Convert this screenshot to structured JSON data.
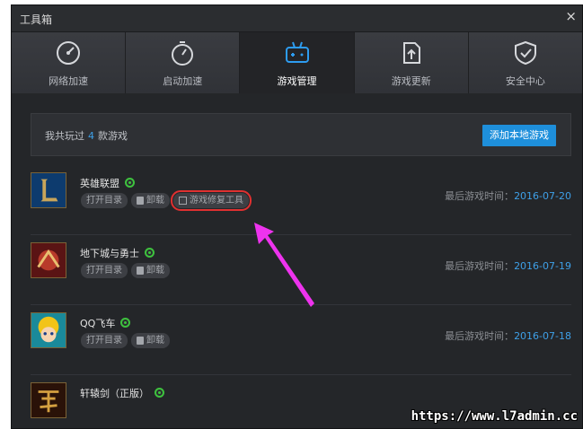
{
  "window": {
    "title": "工具箱",
    "close": "×"
  },
  "tabs": [
    {
      "label": "网络加速",
      "icon": "speedometer-icon"
    },
    {
      "label": "启动加速",
      "icon": "stopwatch-icon"
    },
    {
      "label": "游戏管理",
      "icon": "gamepad-icon",
      "active": true
    },
    {
      "label": "游戏更新",
      "icon": "update-arrow-icon"
    },
    {
      "label": "安全中心",
      "icon": "shield-check-icon"
    }
  ],
  "summary": {
    "prefix": "我共玩过",
    "count": "4",
    "suffix": "款游戏",
    "add_button": "添加本地游戏"
  },
  "games": [
    {
      "name": "英雄联盟",
      "buttons": [
        "打开目录",
        "卸载",
        "游戏修复工具"
      ],
      "last_label": "最后游戏时间：",
      "last_date": "2016-07-20"
    },
    {
      "name": "地下城与勇士",
      "buttons": [
        "打开目录",
        "卸载"
      ],
      "last_label": "最后游戏时间：",
      "last_date": "2016-07-19"
    },
    {
      "name": "QQ飞车",
      "buttons": [
        "打开目录",
        "卸载"
      ],
      "last_label": "最后游戏时间：",
      "last_date": "2016-07-18"
    },
    {
      "name": "轩辕剑（正版）",
      "buttons": [],
      "last_label": "",
      "last_date": ""
    }
  ],
  "colors": {
    "accent": "#1e8fdb",
    "date": "#3ea0e8",
    "highlight": "#e03030",
    "arrow": "#ee33ee"
  },
  "watermark": "https://www.l7admin.cc"
}
